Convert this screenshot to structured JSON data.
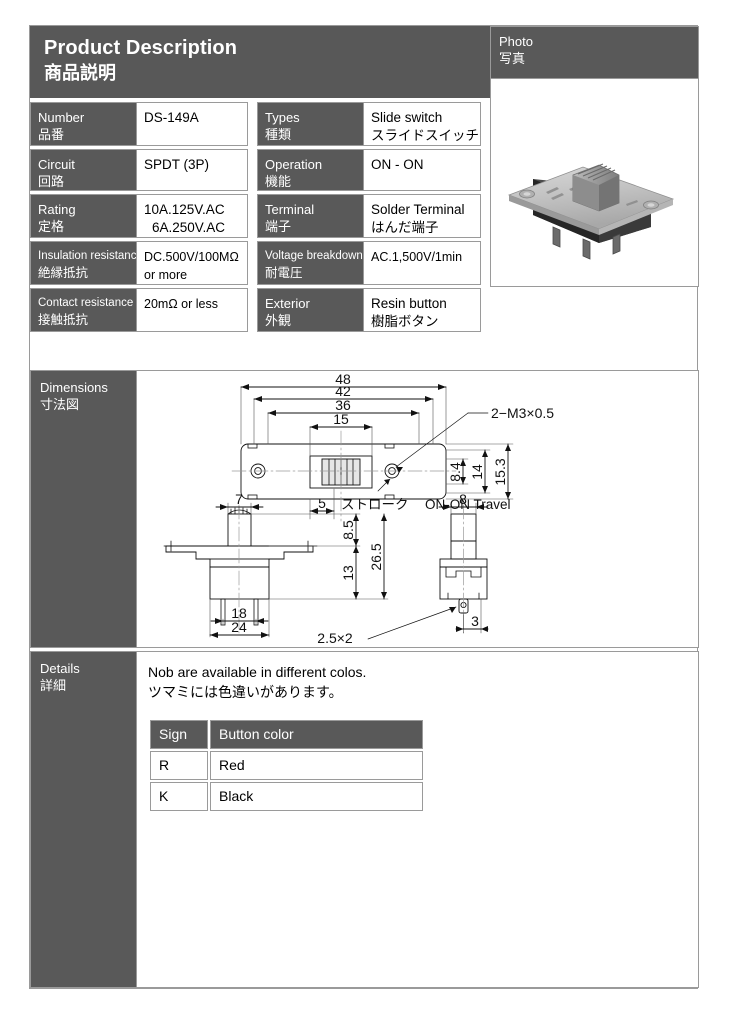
{
  "header": {
    "title_en": "Product Description",
    "title_jp": "商品説明"
  },
  "spec": {
    "rows": [
      {
        "left": {
          "label_en": "Number",
          "label_jp": "品番",
          "values": [
            "DS-149A"
          ]
        },
        "right": {
          "label_en": "Types",
          "label_jp": "種類",
          "values": [
            "Slide switch",
            "スライドスイッチ"
          ]
        }
      },
      {
        "left": {
          "label_en": "Circuit",
          "label_jp": "回路",
          "values": [
            "SPDT (3P)"
          ]
        },
        "right": {
          "label_en": "Operation",
          "label_jp": "機能",
          "values": [
            "ON - ON"
          ]
        }
      },
      {
        "left": {
          "label_en": "Rating",
          "label_jp": "定格",
          "values": [
            "10A.125V.AC",
            "6A.250V.AC"
          ]
        },
        "right": {
          "label_en": "Terminal",
          "label_jp": "端子",
          "values": [
            "Solder Terminal",
            "はんだ端子"
          ]
        }
      },
      {
        "left": {
          "label_en": "Insulation resistance",
          "label_jp": "絶縁抵抗",
          "values": [
            "DC.500V/100MΩ",
            "or more"
          ]
        },
        "right": {
          "label_en": "Voltage breakdown",
          "label_jp": "耐電圧",
          "values": [
            "AC.1,500V/1min"
          ]
        }
      },
      {
        "left": {
          "label_en": "Contact resistance",
          "label_jp": "接触抵抗",
          "values": [
            "20mΩ or less"
          ]
        },
        "right": {
          "label_en": "Exterior",
          "label_jp": "外観",
          "values": [
            "Resin button",
            "樹脂ボタン"
          ]
        }
      }
    ]
  },
  "photo": {
    "label_en": "Photo",
    "label_jp": "写真",
    "alt": "slide-switch-photo"
  },
  "dimensions": {
    "label_en": "Dimensions",
    "label_jp": "寸法図",
    "annotations": {
      "width_overall": "48",
      "width_mount": "42",
      "width_hole_pitch": "36",
      "width_slot": "15",
      "thread_note": "2−M3×0.5",
      "height_hole_offset": "8.4",
      "height_body": "14",
      "height_overall": "15.3",
      "stroke_value": "5",
      "stroke_jp": "ストローク",
      "stroke_en": "ON-ON Travel",
      "knob_width": "7",
      "end_knob_width": "8",
      "knob_height": "8.5",
      "body_height": "13",
      "total_height": "26.5",
      "pin_pitch": "18",
      "body_width": "24",
      "pin_size": "2.5×2",
      "pin_offset": "3"
    }
  },
  "details": {
    "label_en": "Details",
    "label_jp": "詳細",
    "note_en": "Nob are available in different colos.",
    "note_jp": "ツマミには色違いがあります。",
    "table": {
      "headers": [
        "Sign",
        "Button color"
      ],
      "rows": [
        [
          "R",
          "Red"
        ],
        [
          "K",
          "Black"
        ]
      ]
    }
  },
  "colors": {
    "header_gray": "#585858",
    "label_gray": "#595959",
    "border_gray": "#9a9a9a"
  }
}
